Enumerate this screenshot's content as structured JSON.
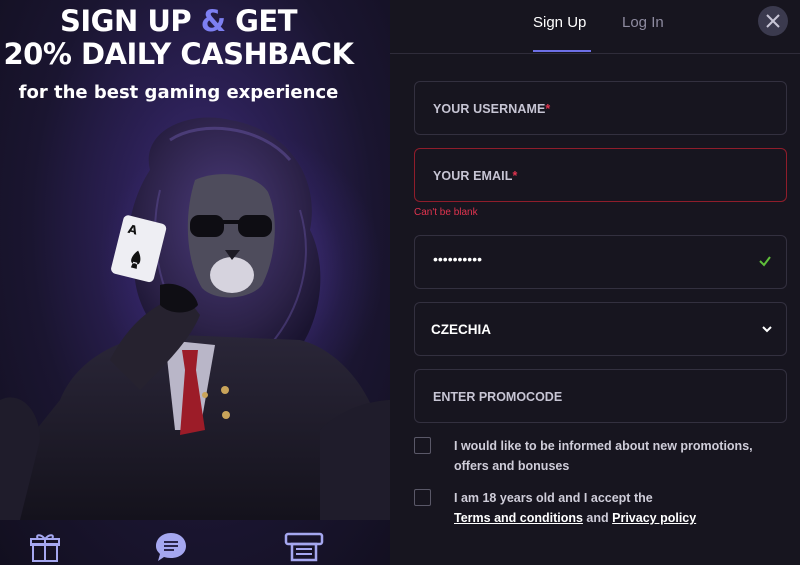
{
  "promo": {
    "headline_part1": "SIGN UP ",
    "headline_amp": "&",
    "headline_part2": " GET",
    "headline_line2": "20% DAILY CASHBACK",
    "subline": "for the best gaming experience",
    "accent_color": "#7d7ff2"
  },
  "bottom_icons": [
    "gift-icon",
    "chat-icon",
    "cashier-icon"
  ],
  "tabs": {
    "signup": "Sign Up",
    "login": "Log In"
  },
  "form": {
    "username_label": "YOUR USERNAME",
    "email_label": "YOUR EMAIL",
    "required_mark": "*",
    "email_error": "Can't be blank",
    "password_value": "••••••••••",
    "country_value": "CZECHIA",
    "promocode_placeholder": "ENTER PROMOCODE",
    "promotions_consent": "I would like to be informed about new promotions, offers and bonuses",
    "age_consent_prefix": "I am 18 years old and I accept the",
    "terms_link": "Terms and conditions",
    "and_text": " and ",
    "privacy_link": "Privacy policy"
  },
  "colors": {
    "error": "#e0344f",
    "success": "#5fbf3a",
    "tab_underline": "#6d6fe6",
    "background": "#17151f"
  }
}
